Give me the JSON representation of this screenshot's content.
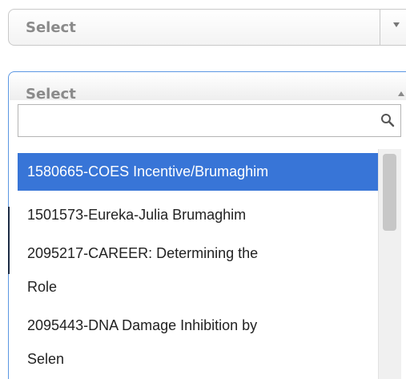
{
  "select_closed": {
    "label": "Select",
    "icon": "chevron-down-icon"
  },
  "select_open": {
    "label": "Select",
    "icon": "chevron-up-icon",
    "search": {
      "value": "",
      "placeholder": "",
      "icon": "search-icon"
    },
    "options": [
      {
        "text": "1580665-COES Incentive/Brumaghim",
        "selected": true
      },
      {
        "text": "1501573-Eureka-Julia Brumaghim",
        "selected": false
      },
      {
        "text": "2095217-CAREER: Determining the\nRole",
        "selected": false
      },
      {
        "text": "2095443-DNA Damage Inhibition by\nSelen",
        "selected": false
      }
    ]
  },
  "colors": {
    "selected_bg": "#3875d7",
    "focus_border": "#5b97e2",
    "label_gray": "#8a8a8a"
  }
}
